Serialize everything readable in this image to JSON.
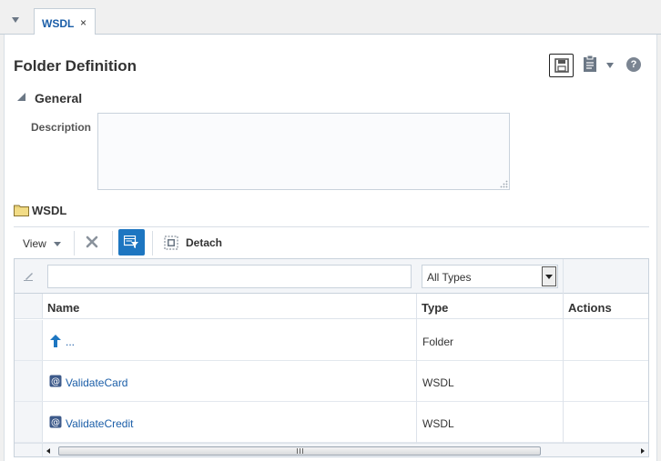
{
  "tabs": [
    {
      "label": "WSDL",
      "close": "×"
    }
  ],
  "page": {
    "title": "Folder Definition",
    "help": "?"
  },
  "general": {
    "heading": "General",
    "description_label": "Description",
    "description_value": ""
  },
  "folder": {
    "label": "WSDL"
  },
  "toolbar": {
    "view_label": "View",
    "detach_label": "Detach"
  },
  "filter": {
    "name_value": "",
    "type_selected": "All Types"
  },
  "table": {
    "columns": [
      "Name",
      "Type",
      "Actions"
    ],
    "rows": [
      {
        "name": "...",
        "type": "Folder",
        "icon": "up-folder-icon"
      },
      {
        "name": "ValidateCard",
        "type": "WSDL",
        "icon": "wsdl-icon"
      },
      {
        "name": "ValidateCredit",
        "type": "WSDL",
        "icon": "wsdl-icon"
      }
    ]
  },
  "colors": {
    "accent": "#1b5ea8",
    "filter_active": "#1d76c1"
  }
}
